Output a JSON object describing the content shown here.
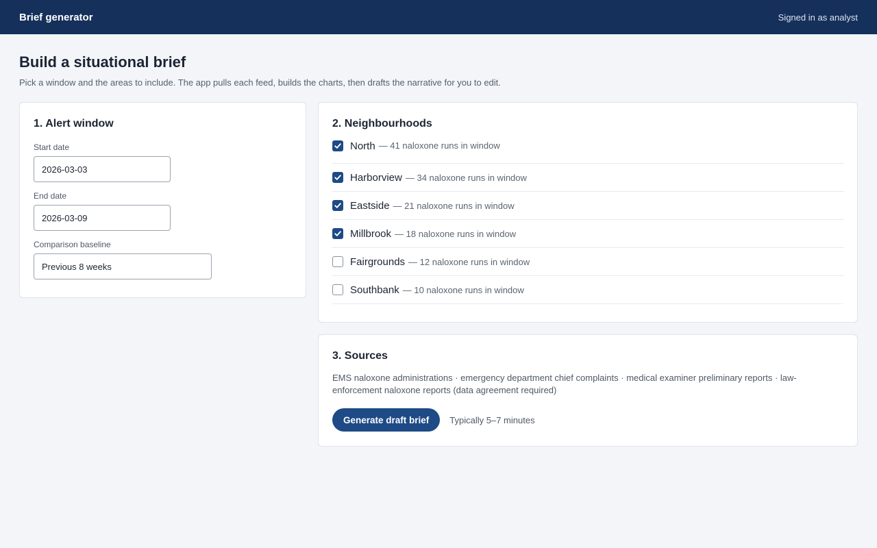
{
  "header": {
    "app_title": "Brief generator",
    "signed_in": "Signed in as analyst"
  },
  "page": {
    "title": "Build a situational brief",
    "subtitle": "Pick a window and the areas to include. The app pulls each feed, builds the charts, then drafts the narrative for you to edit."
  },
  "alert_window": {
    "title": "1. Alert window",
    "start_label": "Start date",
    "start_value": "2026-03-03",
    "end_label": "End date",
    "end_value": "2026-03-09",
    "baseline_label": "Comparison baseline",
    "baseline_value": "Previous 8 weeks"
  },
  "neighbourhoods": {
    "title": "2. Neighbourhoods",
    "items": [
      {
        "name": "North",
        "meta": "— 41 naloxone runs in window",
        "checked": true
      },
      {
        "name": "Harborview",
        "meta": "— 34 naloxone runs in window",
        "checked": true
      },
      {
        "name": "Eastside",
        "meta": "— 21 naloxone runs in window",
        "checked": true
      },
      {
        "name": "Millbrook",
        "meta": "— 18 naloxone runs in window",
        "checked": true
      },
      {
        "name": "Fairgrounds",
        "meta": "— 12 naloxone runs in window",
        "checked": false
      },
      {
        "name": "Southbank",
        "meta": "— 10 naloxone runs in window",
        "checked": false
      }
    ]
  },
  "sources": {
    "title": "3. Sources",
    "text": "EMS naloxone administrations · emergency department chief complaints · medical examiner preliminary reports · law-enforcement naloxone reports (data agreement required)",
    "generate_label": "Generate draft brief",
    "eta": "Typically 5–7 minutes"
  },
  "colors": {
    "topbar": "#15305a",
    "accent": "#1e4a86",
    "background": "#f3f5f9"
  },
  "icons": {
    "checkbox_checked": "check-icon"
  }
}
